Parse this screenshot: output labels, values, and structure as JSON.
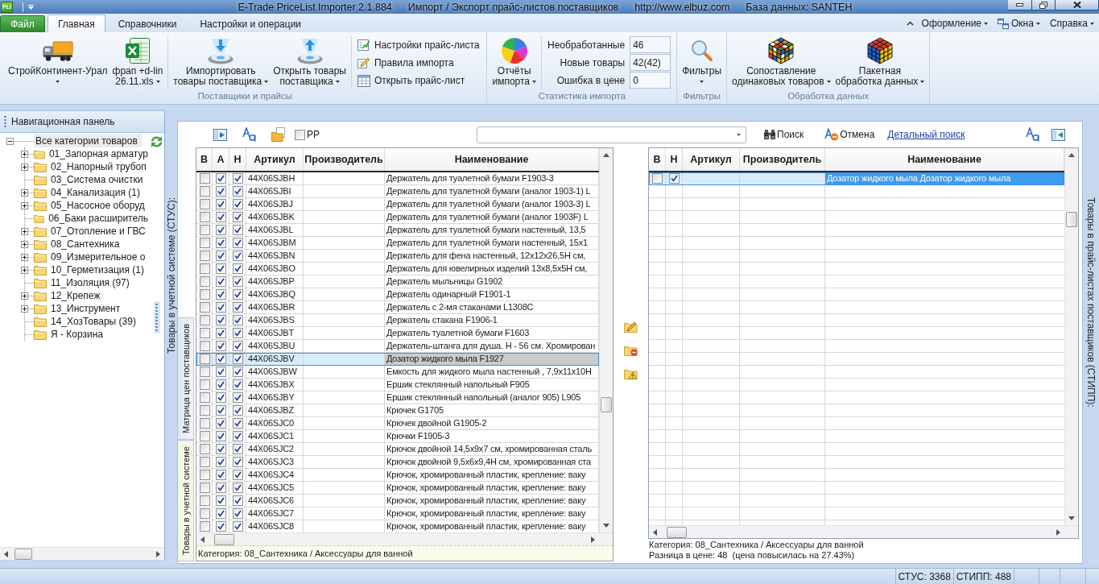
{
  "title_bar": {
    "app_badge": "PLI",
    "segments": [
      "E-Trade PriceList Importer 2.1.884",
      "Импорт / Экспорт прайс-листов поставщиков",
      "http://www.elbuz.com",
      "База данных: SANTEH"
    ]
  },
  "menu_bar": {
    "file_button": "Файл",
    "tabs": [
      {
        "label": "Главная",
        "selected": true
      },
      {
        "label": "Справочники",
        "selected": false
      },
      {
        "label": "Настройки и операции",
        "selected": false
      }
    ],
    "right_menus": [
      "Оформление",
      "Окна",
      "Справка"
    ]
  },
  "ribbon": {
    "groups": [
      {
        "label": "Поставщики и прайсы",
        "items": [
          {
            "kind": "large",
            "lines": [
              "СтройКонтинент-Урал"
            ],
            "dropdown": true
          },
          {
            "kind": "large",
            "lines": [
              "фрап +d-lin",
              "26.11.xls"
            ],
            "dropdown": true
          },
          {
            "kind": "separator"
          },
          {
            "kind": "large",
            "lines": [
              "Импортировать",
              "товары поставщика"
            ],
            "dropdown": true
          },
          {
            "kind": "large",
            "lines": [
              "Открыть товары",
              "поставщика"
            ],
            "dropdown": true
          },
          {
            "kind": "separator"
          },
          {
            "kind": "small_list",
            "buttons": [
              "Настройки прайс-листа",
              "Правила импорта",
              "Открыть прайс-лист"
            ]
          }
        ]
      },
      {
        "label": "Статистика импорта",
        "items": [
          {
            "kind": "large",
            "lines": [
              "Отчёты",
              "импорта"
            ],
            "dropdown": true
          },
          {
            "kind": "separator"
          },
          {
            "kind": "stats",
            "rows": [
              {
                "label": "Необработанные",
                "value": "46"
              },
              {
                "label": "Новые товары",
                "value": "42(42)"
              },
              {
                "label": "Ошибка в цене",
                "value": "0"
              }
            ]
          }
        ]
      },
      {
        "label": "Фильтры",
        "items": [
          {
            "kind": "large",
            "lines": [
              "Фильтры"
            ],
            "dropdown": true
          }
        ]
      },
      {
        "label": "Обработка данных",
        "items": [
          {
            "kind": "large",
            "lines": [
              "Сопоставление",
              "одинаковых товаров"
            ],
            "dropdown": true
          },
          {
            "kind": "large",
            "lines": [
              "Пакетная",
              "обработка данных"
            ],
            "dropdown": true
          }
        ]
      }
    ]
  },
  "nav_panel": {
    "title": "Навигационная панель",
    "tree": {
      "label": "Все категории товаров",
      "expanded": true,
      "selected": true,
      "children": [
        {
          "label": "01_Запорная арматур",
          "expanded": false,
          "selected": false
        },
        {
          "label": "02_Напорный трубоп",
          "expanded": false,
          "selected": false
        },
        {
          "label": "03_Система очистки",
          "selected": false
        },
        {
          "label": "04_Канализация (1)",
          "expanded": false,
          "selected": false
        },
        {
          "label": "05_Насосное оборуд",
          "expanded": false,
          "selected": false
        },
        {
          "label": "06_Баки расширитель",
          "selected": false
        },
        {
          "label": "07_Отопление и ГВС",
          "expanded": false,
          "selected": false
        },
        {
          "label": "08_Сантехника",
          "expanded": false,
          "selected": false
        },
        {
          "label": "09_Измерительное о",
          "expanded": false,
          "selected": false
        },
        {
          "label": "10_Герметизация (1)",
          "expanded": false,
          "selected": false
        },
        {
          "label": "11_Изоляция (97)",
          "selected": false
        },
        {
          "label": "12_Крепеж",
          "expanded": false,
          "selected": false
        },
        {
          "label": "13_Инструмент",
          "expanded": false,
          "selected": false
        },
        {
          "label": "14_ХозТовары (39)",
          "selected": false
        },
        {
          "label": "Я - Корзина",
          "selected": false
        }
      ]
    }
  },
  "content": {
    "caption_left": "Товары в учетной системе (СТУС):",
    "caption_right": "Товары в прайс-листах поставщиков (СТИПП):",
    "vertical_tabs": [
      {
        "label": "Матрица цен поставщиков",
        "selected": false
      },
      {
        "label": "Товары в учетной системе",
        "selected": true
      }
    ],
    "toolbar": {
      "pp": {
        "label": "PP",
        "checked": false
      },
      "search_button": "Поиск",
      "cancel_button": "Отмена",
      "detail_search_link": "Детальный поиск"
    },
    "left_grid": {
      "columns": [
        "В",
        "А",
        "Н",
        "Артикул",
        "Производитель",
        "Наименование"
      ],
      "rows": [
        {
          "checks": [
            false,
            true,
            true
          ],
          "article": "44X06SJBH",
          "name": "Держатель для туалетной бумаги F1903-3",
          "selected": false
        },
        {
          "checks": [
            false,
            true,
            true
          ],
          "article": "44X06SJBI",
          "name": "Держатель для туалетной бумаги (аналог 1903-1) L",
          "selected": false
        },
        {
          "checks": [
            false,
            true,
            true
          ],
          "article": "44X06SJBJ",
          "name": "Держатель для туалетной бумаги (аналог 1903-3) L",
          "selected": false
        },
        {
          "checks": [
            false,
            true,
            true
          ],
          "article": "44X06SJBK",
          "name": "Держатель для туалетной бумаги (аналог 1903F) L",
          "selected": false
        },
        {
          "checks": [
            false,
            true,
            true
          ],
          "article": "44X06SJBL",
          "name": "Держатель для туалетной бумаги настенный, 13,5",
          "selected": false
        },
        {
          "checks": [
            false,
            true,
            true
          ],
          "article": "44X06SJBM",
          "name": "Держатель для туалетной бумаги настенный, 15х1",
          "selected": false
        },
        {
          "checks": [
            false,
            true,
            true
          ],
          "article": "44X06SJBN",
          "name": "Держатель для фена настенный, 12х12х26,5Н см,",
          "selected": false
        },
        {
          "checks": [
            false,
            true,
            true
          ],
          "article": "44X06SJBO",
          "name": "Держатель для ювелирных изделий 13х8,5х5Н см,",
          "selected": false
        },
        {
          "checks": [
            false,
            true,
            true
          ],
          "article": "44X06SJBP",
          "name": "Держатель мыльницы G1902",
          "selected": false
        },
        {
          "checks": [
            false,
            true,
            true
          ],
          "article": "44X06SJBQ",
          "name": "Держатель одинарный F1901-1",
          "selected": false
        },
        {
          "checks": [
            false,
            true,
            true
          ],
          "article": "44X06SJBR",
          "name": "Держатель с 2-мя стаканами L1308C",
          "selected": false
        },
        {
          "checks": [
            false,
            true,
            true
          ],
          "article": "44X06SJBS",
          "name": "Держатель стакана F1906-1",
          "selected": false
        },
        {
          "checks": [
            false,
            true,
            true
          ],
          "article": "44X06SJBT",
          "name": "Держатель туалетной бумаги F1603",
          "selected": false
        },
        {
          "checks": [
            false,
            true,
            true
          ],
          "article": "44X06SJBU",
          "name": "Держатель-штанга для душа. Н - 56 см. Хромирован",
          "selected": false
        },
        {
          "checks": [
            false,
            true,
            true
          ],
          "article": "44X06SJBV",
          "name": "Дозатор жидкого мыла F1927",
          "selected": true
        },
        {
          "checks": [
            false,
            true,
            true
          ],
          "article": "44X06SJBW",
          "name": "Емкость для жидкого мыла настенный , 7,9х11х10Н",
          "selected": false
        },
        {
          "checks": [
            false,
            true,
            true
          ],
          "article": "44X06SJBX",
          "name": "Ершик стеклянный напольный F905",
          "selected": false
        },
        {
          "checks": [
            false,
            true,
            true
          ],
          "article": "44X06SJBY",
          "name": "Ершик стеклянный напольный (аналог 905) L905",
          "selected": false
        },
        {
          "checks": [
            false,
            true,
            true
          ],
          "article": "44X06SJBZ",
          "name": "Крючек G1705",
          "selected": false
        },
        {
          "checks": [
            false,
            true,
            true
          ],
          "article": "44X06SJC0",
          "name": "Крючек двойной G1905-2",
          "selected": false
        },
        {
          "checks": [
            false,
            true,
            true
          ],
          "article": "44X06SJC1",
          "name": "Крючки F1905-3",
          "selected": false
        },
        {
          "checks": [
            false,
            true,
            true
          ],
          "article": "44X06SJC2",
          "name": "Крючок двойной 14,5х9х7 см, хромированная сталь",
          "selected": false
        },
        {
          "checks": [
            false,
            true,
            true
          ],
          "article": "44X06SJC3",
          "name": "Крючок двойной 9,5х6х9,4Н см, хромированная ста",
          "selected": false
        },
        {
          "checks": [
            false,
            true,
            true
          ],
          "article": "44X06SJC4",
          "name": "Крючок, хромированный пластик, крепление: ваку",
          "selected": false
        },
        {
          "checks": [
            false,
            true,
            true
          ],
          "article": "44X06SJC5",
          "name": "Крючок, хромированный пластик, крепление: ваку",
          "selected": false
        },
        {
          "checks": [
            false,
            true,
            true
          ],
          "article": "44X06SJC6",
          "name": "Крючок, хромированный пластик, крепление: ваку",
          "selected": false
        },
        {
          "checks": [
            false,
            true,
            true
          ],
          "article": "44X06SJC7",
          "name": "Крючок, хромированный пластик, крепление: ваку",
          "selected": false
        },
        {
          "checks": [
            false,
            true,
            true
          ],
          "article": "44X06SJC8",
          "name": "Крючок, хромированный пластик, крепление: ваку",
          "selected": false
        }
      ],
      "footer": "Категория: 08_Сантехника / Аксессуары для ванной"
    },
    "right_grid": {
      "columns": [
        "В",
        "Н",
        "Артикул",
        "Производитель",
        "Наименование"
      ],
      "rows": [
        {
          "checks": [
            false,
            true
          ],
          "name": "Дозатор жидкого мыла Дозатор жидкого мыла",
          "selected": true
        }
      ],
      "footer_lines": [
        "Категория: 08_Сантехника / Аксессуары для ванной",
        "Разница в цене: 48  (цена повысилась на 27.43%)"
      ]
    }
  },
  "status_bar": {
    "items": [
      "СТУС: 3368",
      "СТИПП: 488"
    ]
  }
}
